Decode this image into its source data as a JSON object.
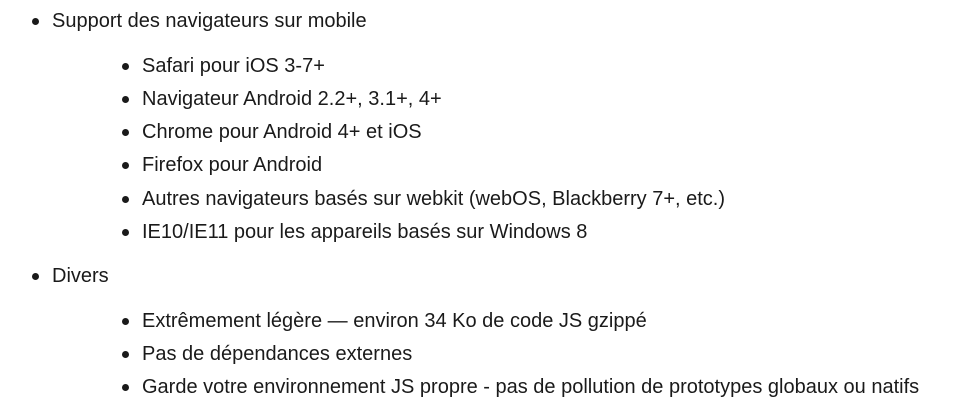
{
  "sections": [
    {
      "title": "Support des navigateurs sur mobile",
      "items": [
        "Safari pour iOS 3-7+",
        "Navigateur Android 2.2+, 3.1+, 4+",
        "Chrome pour Android 4+ et iOS",
        "Firefox pour Android",
        "Autres navigateurs basés sur webkit (webOS, Blackberry 7+, etc.)",
        "IE10/IE11 pour les appareils basés sur Windows 8"
      ]
    },
    {
      "title": "Divers",
      "items": [
        "Extrêmement légère — environ 34 Ko de code JS gzippé",
        "Pas de dépendances externes",
        "Garde votre environnement JS propre - pas de pollution de prototypes globaux ou natifs"
      ]
    }
  ]
}
